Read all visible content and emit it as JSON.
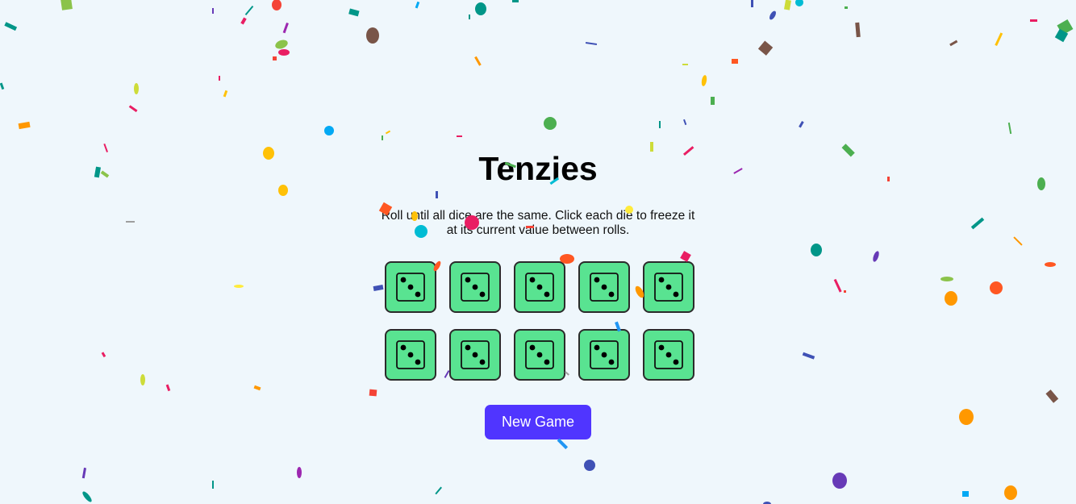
{
  "game": {
    "title": "Tenzies",
    "instructions": "Roll until all dice are the same. Click each die to freeze it at its current value between rolls.",
    "new_game_label": "New Game",
    "won": true
  },
  "dice": [
    {
      "value": 3,
      "held": true
    },
    {
      "value": 3,
      "held": true
    },
    {
      "value": 3,
      "held": true
    },
    {
      "value": 3,
      "held": true
    },
    {
      "value": 3,
      "held": true
    },
    {
      "value": 3,
      "held": true
    },
    {
      "value": 3,
      "held": true
    },
    {
      "value": 3,
      "held": true
    },
    {
      "value": 3,
      "held": true
    },
    {
      "value": 3,
      "held": true
    }
  ],
  "colors": {
    "background": "#eff7fc",
    "die_held": "#59e391",
    "die_border": "#2b2b2b",
    "button": "#5035ff",
    "button_text": "#ffffff"
  },
  "icons": {
    "die_face": "die-three-icon",
    "confetti": "confetti-piece"
  }
}
